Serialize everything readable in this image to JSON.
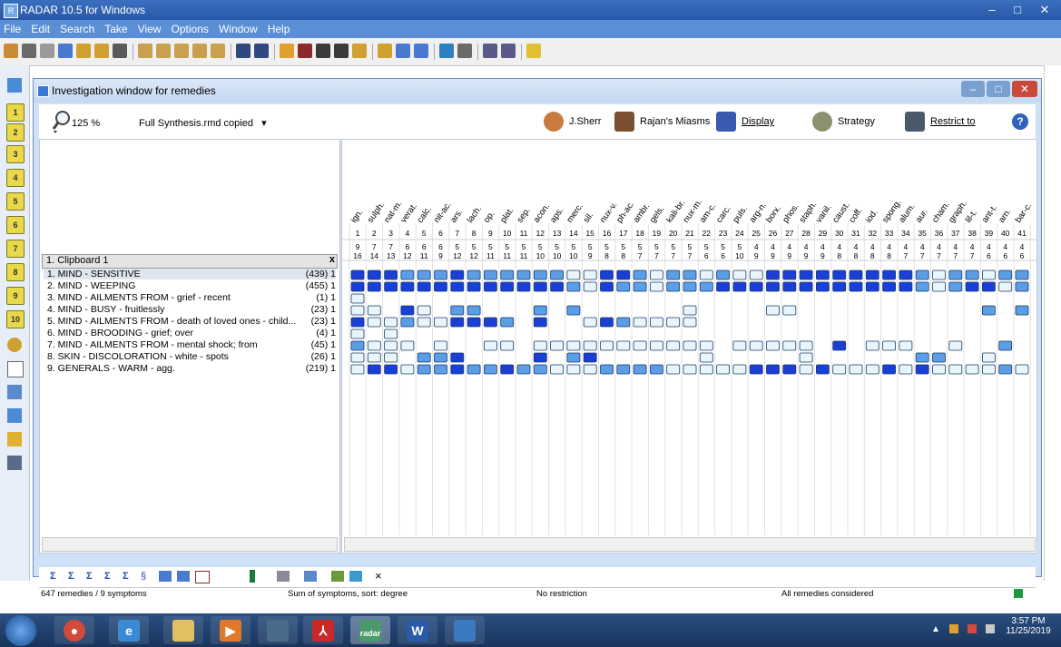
{
  "app": {
    "title": "RADAR 10.5 for Windows"
  },
  "menu": [
    "File",
    "Edit",
    "Search",
    "Take",
    "View",
    "Options",
    "Window",
    "Help"
  ],
  "investigation": {
    "title": "Investigation window for remedies",
    "zoom": "125 %",
    "synthesis": "Full Synthesis.rmd copied",
    "buttons": {
      "sherr": "J.Sherr",
      "rajan": "Rajan's Miasms",
      "display": "Display",
      "strategy": "Strategy",
      "restrict": "Restrict to"
    },
    "clipboard_label": "1. Clipboard 1",
    "symptoms": [
      {
        "label": "1. MIND - SENSITIVE",
        "count": "(439) 1"
      },
      {
        "label": "2. MIND - WEEPING",
        "count": "(455) 1"
      },
      {
        "label": "3. MIND - AILMENTS FROM - grief - recent",
        "count": "(1) 1"
      },
      {
        "label": "4. MIND - BUSY - fruitlessly",
        "count": "(23) 1"
      },
      {
        "label": "5. MIND - AILMENTS FROM - death of loved ones - child...",
        "count": "(23) 1"
      },
      {
        "label": "6. MIND - BROODING - grief; over",
        "count": "(4) 1"
      },
      {
        "label": "7. MIND - AILMENTS FROM - mental shock; from",
        "count": "(45) 1"
      },
      {
        "label": "8. SKIN - DISCOLORATION - white - spots",
        "count": "(26) 1"
      },
      {
        "label": "9. GENERALS - WARM - agg.",
        "count": "(219) 1"
      }
    ],
    "remedies": [
      "ign.",
      "sulph.",
      "nat-m.",
      "verat.",
      "calc.",
      "nit-ac.",
      "ars.",
      "lach.",
      "op.",
      "plat.",
      "sep.",
      "acon.",
      "aps.",
      "merc.",
      "sil.",
      "nux-v.",
      "ph-ac.",
      "ambr.",
      "gels.",
      "kali-br.",
      "nux-m.",
      "am-c.",
      "carc.",
      "puls.",
      "arg-n.",
      "borx.",
      "phos.",
      "staph.",
      "vanil.",
      "caust.",
      "coff.",
      "iod.",
      "spong.",
      "alum.",
      "aur.",
      "cham.",
      "graph.",
      "lil-t.",
      "ant-t.",
      "arn.",
      "bar-c."
    ],
    "rem_index": [
      "1",
      "2",
      "3",
      "4",
      "5",
      "6",
      "7",
      "8",
      "9",
      "10",
      "11",
      "12",
      "13",
      "14",
      "15",
      "16",
      "17",
      "18",
      "19",
      "20",
      "21",
      "22",
      "23",
      "24",
      "25",
      "26",
      "27",
      "28",
      "29",
      "30",
      "31",
      "32",
      "33",
      "34",
      "35",
      "36",
      "37",
      "38",
      "39",
      "40",
      "41"
    ],
    "sym_counts": [
      "9",
      "7",
      "7",
      "6",
      "6",
      "6",
      "5",
      "5",
      "5",
      "5",
      "5",
      "5",
      "5",
      "5",
      "5",
      "5",
      "5",
      "5",
      "5",
      "5",
      "5",
      "5",
      "5",
      "5",
      "4",
      "4",
      "4",
      "4",
      "4",
      "4",
      "4",
      "4",
      "4",
      "4",
      "4",
      "4",
      "4",
      "4",
      "4",
      "4",
      "4"
    ],
    "degree_sums": [
      "16",
      "14",
      "13",
      "12",
      "11",
      "9",
      "12",
      "12",
      "11",
      "11",
      "11",
      "10",
      "10",
      "10",
      "9",
      "8",
      "8",
      "7",
      "7",
      "7",
      "7",
      "6",
      "6",
      "10",
      "9",
      "9",
      "9",
      "9",
      "9",
      "8",
      "8",
      "8",
      "8",
      "7",
      "7",
      "7",
      "7",
      "7",
      "6",
      "6",
      "6"
    ],
    "grid": [
      [
        3,
        3,
        3,
        2,
        2,
        2,
        3,
        2,
        2,
        2,
        2,
        2,
        2,
        1,
        1,
        3,
        3,
        2,
        1,
        2,
        2,
        1,
        2,
        1,
        1,
        3,
        3,
        3,
        3,
        3,
        3,
        3,
        3,
        3,
        2,
        1,
        2,
        2,
        1,
        2,
        2,
        2,
        2
      ],
      [
        3,
        3,
        3,
        3,
        3,
        3,
        3,
        3,
        3,
        3,
        3,
        3,
        3,
        2,
        1,
        3,
        2,
        2,
        1,
        2,
        2,
        2,
        3,
        3,
        3,
        3,
        3,
        3,
        3,
        3,
        3,
        3,
        3,
        3,
        2,
        1,
        2,
        3,
        3,
        1,
        2,
        3
      ],
      [
        1,
        0,
        0,
        0,
        0,
        0,
        0,
        0,
        0,
        0,
        0,
        0,
        0,
        0,
        0,
        0,
        0,
        0,
        0,
        0,
        0,
        0,
        0,
        0,
        0,
        0,
        0,
        0,
        0,
        0,
        0,
        0,
        0,
        0,
        0,
        0,
        0,
        0,
        0,
        0,
        0
      ],
      [
        1,
        1,
        0,
        3,
        1,
        0,
        2,
        2,
        0,
        0,
        0,
        2,
        0,
        2,
        0,
        0,
        0,
        0,
        0,
        0,
        1,
        0,
        0,
        0,
        0,
        1,
        1,
        0,
        0,
        0,
        0,
        0,
        0,
        0,
        0,
        0,
        0,
        0,
        2,
        0,
        2
      ],
      [
        3,
        1,
        1,
        2,
        1,
        1,
        3,
        3,
        3,
        2,
        0,
        3,
        0,
        0,
        1,
        3,
        2,
        1,
        1,
        1,
        1,
        0,
        0,
        0,
        0,
        0,
        0,
        0,
        0,
        0,
        0,
        0,
        0,
        0,
        0,
        0,
        0,
        0,
        0,
        0,
        0
      ],
      [
        1,
        0,
        1,
        0,
        0,
        0,
        0,
        0,
        0,
        0,
        0,
        0,
        0,
        0,
        0,
        0,
        0,
        0,
        0,
        0,
        0,
        0,
        0,
        0,
        0,
        0,
        0,
        0,
        0,
        0,
        0,
        0,
        0,
        0,
        0,
        0,
        0,
        0,
        0,
        0,
        0
      ],
      [
        2,
        1,
        1,
        1,
        0,
        1,
        0,
        0,
        1,
        1,
        0,
        1,
        1,
        1,
        1,
        1,
        1,
        1,
        1,
        1,
        1,
        1,
        0,
        1,
        1,
        1,
        1,
        1,
        0,
        3,
        0,
        1,
        1,
        1,
        0,
        0,
        1,
        0,
        0,
        2,
        0
      ],
      [
        1,
        1,
        1,
        0,
        2,
        2,
        3,
        0,
        0,
        0,
        0,
        3,
        0,
        2,
        3,
        0,
        0,
        0,
        0,
        0,
        0,
        1,
        0,
        0,
        0,
        0,
        0,
        1,
        0,
        0,
        0,
        0,
        0,
        0,
        2,
        2,
        0,
        0,
        1,
        0,
        0
      ],
      [
        1,
        3,
        3,
        1,
        2,
        2,
        3,
        2,
        2,
        3,
        2,
        2,
        1,
        1,
        1,
        2,
        2,
        2,
        2,
        1,
        1,
        1,
        1,
        1,
        3,
        3,
        3,
        1,
        3,
        1,
        1,
        1,
        3,
        1,
        3,
        1,
        1,
        1,
        1,
        2,
        1
      ]
    ],
    "status": {
      "left": "647 remedies / 9 symptoms",
      "sort": "Sum of symptoms, sort: degree",
      "restrict": "No restriction",
      "all": "All remedies considered"
    }
  },
  "taskbar": {
    "time": "3:57 PM",
    "date": "11/25/2019",
    "radar_label": "radar"
  },
  "colors": {
    "titlebar": "#2a58a8",
    "menubar": "#5a8fd6",
    "deg3": "#1a3fd6",
    "deg2": "#5b9ee6",
    "deg1": "#e8f6fb",
    "grid_border": "#1a3a6a",
    "taskbar": "#1f3f6e"
  }
}
